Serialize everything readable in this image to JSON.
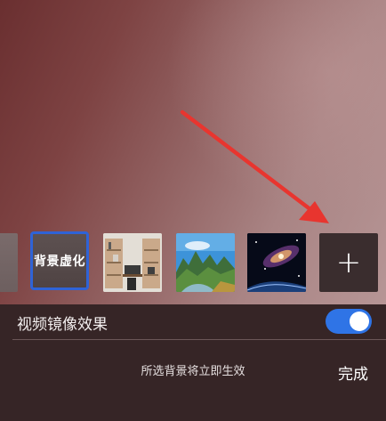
{
  "background_options": {
    "blur_label": "背景虚化",
    "add_icon": "plus-icon",
    "items": [
      {
        "name": "partial-previous",
        "selected": false
      },
      {
        "name": "background-blur",
        "selected": true
      },
      {
        "name": "bookshelf-room",
        "selected": false
      },
      {
        "name": "mountain-river",
        "selected": false
      },
      {
        "name": "galaxy-space",
        "selected": false
      }
    ]
  },
  "settings": {
    "mirror_effect_label": "视频镜像效果",
    "mirror_effect_on": true
  },
  "footer": {
    "hint": "所选背景将立即生效",
    "done_label": "完成"
  },
  "colors": {
    "accent": "#2f74e6",
    "selected_border": "#2f63d6",
    "annotation_arrow": "#e8352f"
  }
}
